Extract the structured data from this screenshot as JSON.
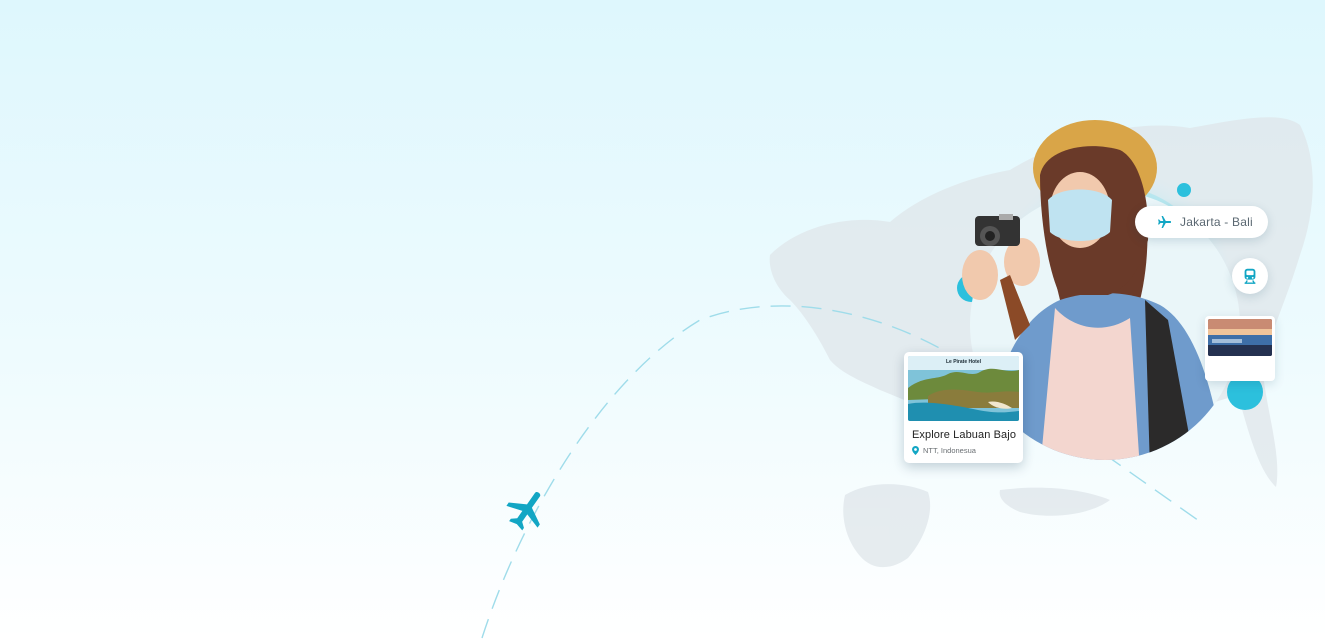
{
  "route_pill": {
    "icon": "plane-icon",
    "label": "Jakarta - Bali"
  },
  "train_button": {
    "icon": "train-icon"
  },
  "hotel_thumbnail": {
    "image": "hotel-pool-photo"
  },
  "destination_card": {
    "photo_caption": "Le Pirate Hotel",
    "title": "Explore Labuan Bajo",
    "location_icon": "location-pin-icon",
    "location": "NTT, Indonesua"
  },
  "colors": {
    "accent": "#12a6c4",
    "background_top": "#def7fd",
    "background_bottom": "#ffffff"
  }
}
